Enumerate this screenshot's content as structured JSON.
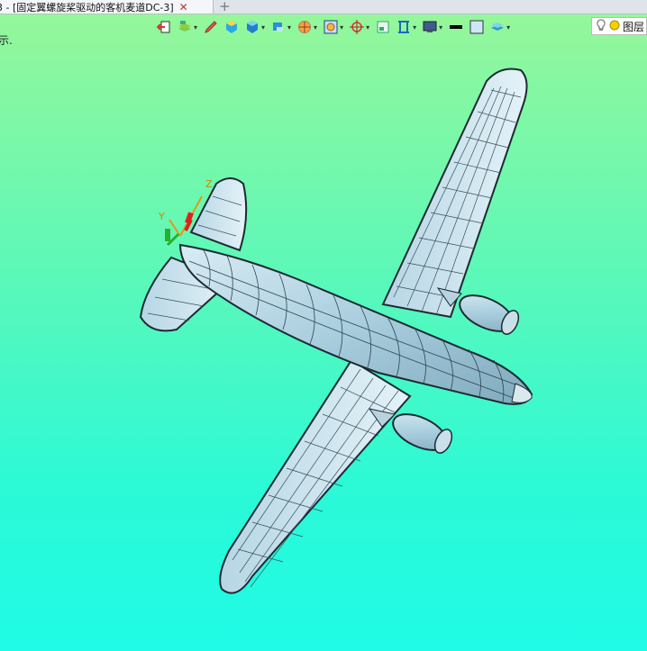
{
  "tab": {
    "title": "3 - [固定翼螺旋桨驱动的客机麦道DC-3]",
    "close_glyph": "✕",
    "new_glyph": "+"
  },
  "status": {
    "text": "示."
  },
  "toolbar": {
    "buttons": [
      {
        "icon": "exit-icon",
        "dropdown": false
      },
      {
        "icon": "layers-stack-icon",
        "dropdown": true
      },
      {
        "icon": "pencil-icon",
        "dropdown": false
      },
      {
        "icon": "cube-yellow-icon",
        "dropdown": false
      },
      {
        "icon": "cube-shaded-icon",
        "dropdown": true
      },
      {
        "icon": "cube-display-icon",
        "dropdown": true
      },
      {
        "icon": "render-mode-icon",
        "dropdown": true
      },
      {
        "icon": "zoom-fit-icon",
        "dropdown": true
      },
      {
        "icon": "orient-icon",
        "dropdown": true
      },
      {
        "icon": "view-box-icon",
        "dropdown": false
      },
      {
        "icon": "section-icon",
        "dropdown": true
      },
      {
        "icon": "screen-icon",
        "dropdown": true
      },
      {
        "icon": "line-color-icon",
        "dropdown": false
      },
      {
        "icon": "fill-color-icon",
        "dropdown": false
      },
      {
        "icon": "layer-planes-icon",
        "dropdown": true
      }
    ],
    "layer_label": "图层"
  },
  "viewport": {
    "bg_top": "#95f79a",
    "bg_bottom": "#1ffbe6"
  },
  "triad": {
    "y_label": "Y",
    "z_label": "Z"
  }
}
